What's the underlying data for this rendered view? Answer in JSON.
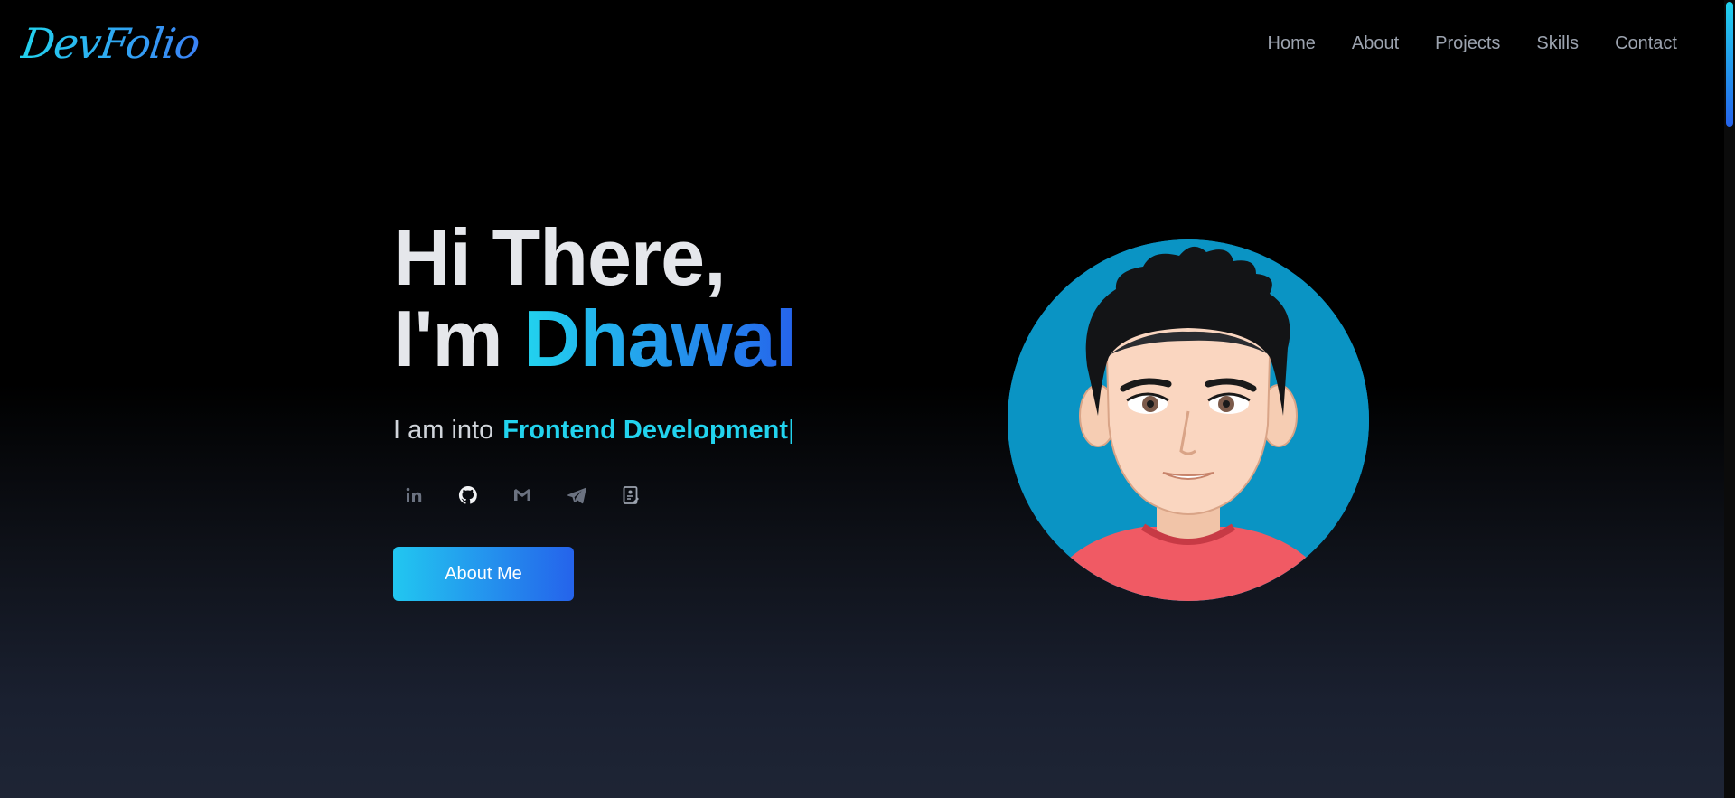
{
  "brand": {
    "logo": "DevFolio"
  },
  "nav": {
    "items": [
      {
        "label": "Home"
      },
      {
        "label": "About"
      },
      {
        "label": "Projects"
      },
      {
        "label": "Skills"
      },
      {
        "label": "Contact"
      }
    ]
  },
  "hero": {
    "line1": "Hi There,",
    "line2_prefix": "I'm ",
    "name": "Dhawal",
    "tagline_prefix": "I am into",
    "tagline_typed": "Frontend Development",
    "cursor": "|",
    "button_label": "About Me"
  },
  "socials": [
    {
      "icon": "linkedin-icon"
    },
    {
      "icon": "github-icon"
    },
    {
      "icon": "gmail-icon"
    },
    {
      "icon": "telegram-icon"
    },
    {
      "icon": "resume-icon"
    }
  ],
  "colors": {
    "accent_start": "#22d3ee",
    "accent_end": "#2563eb",
    "avatar_bg": "#0a94c4",
    "shirt": "#f05a64"
  }
}
